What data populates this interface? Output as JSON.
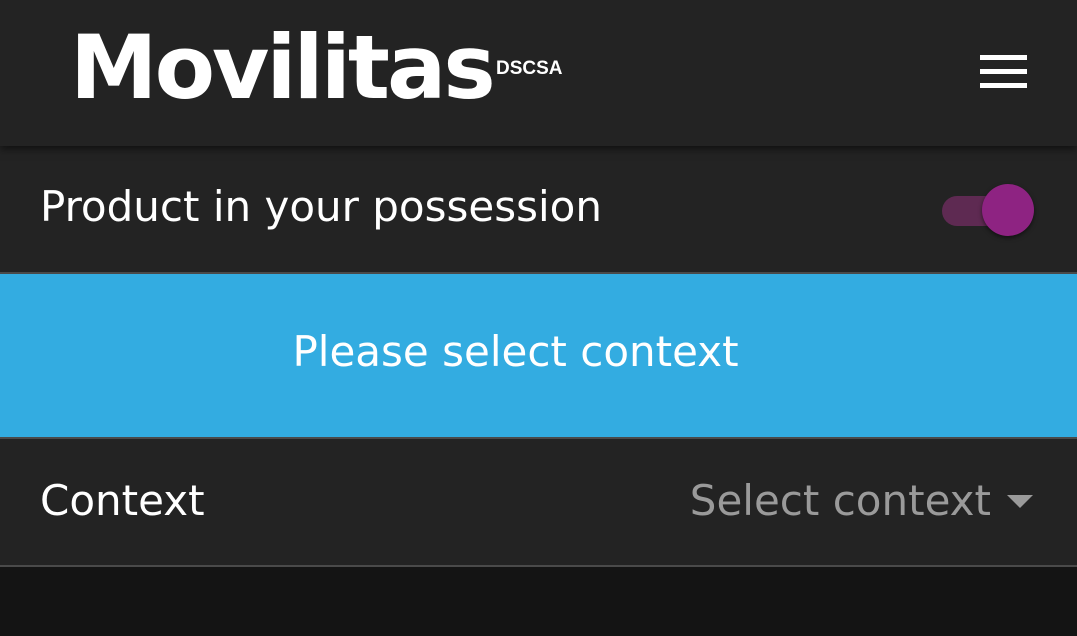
{
  "header": {
    "logo_text": "Movilitas",
    "logo_sub": "DSCSA",
    "menu_icon": "hamburger-menu-icon"
  },
  "possession": {
    "label": "Product in your possession",
    "toggle_on": true,
    "toggle_color": "#8e2382"
  },
  "banner": {
    "text": "Please select context",
    "color": "#33ace1"
  },
  "context": {
    "label": "Context",
    "placeholder": "Select context",
    "arrow_icon": "dropdown-arrow-icon"
  }
}
